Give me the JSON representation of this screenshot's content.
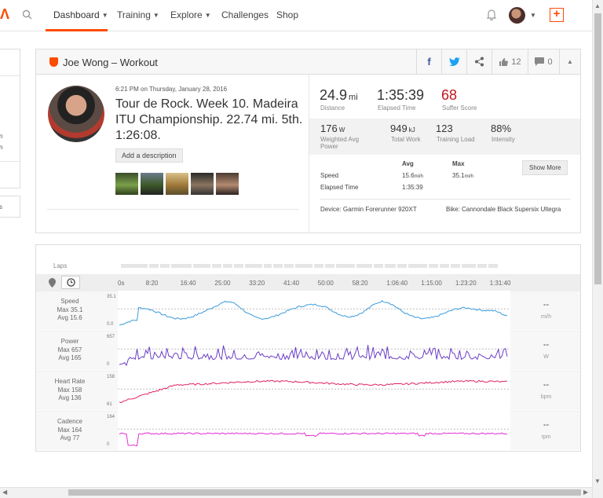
{
  "nav": {
    "items": [
      {
        "label": "Dashboard",
        "caret": true
      },
      {
        "label": "Training",
        "caret": true
      },
      {
        "label": "Explore",
        "caret": true
      },
      {
        "label": "Challenges",
        "caret": false
      },
      {
        "label": "Shop",
        "caret": false
      }
    ]
  },
  "activity": {
    "header_title": "Joe Wong – Workout",
    "kudos_count": "12",
    "comments_count": "0",
    "date": "6:21 PM on Thursday, January 28, 2016",
    "title": "Tour de Rock. Week 10. Madeira ITU Championship. 22.74 mi. 5th. 1:26:08.",
    "add_description": "Add a description",
    "stats": {
      "distance_value": "24.9",
      "distance_unit": "mi",
      "distance_label": "Distance",
      "elapsed_value": "1:35:39",
      "elapsed_label": "Elapsed Time",
      "suffer_value": "68",
      "suffer_label": "Suffer Score",
      "power_value": "176",
      "power_unit": "W",
      "power_label": "Weighted Avg Power",
      "work_value": "949",
      "work_unit": "kJ",
      "work_label": "Total Work",
      "load_value": "123",
      "load_label": "Training Load",
      "intensity_value": "88%",
      "intensity_label": "Intensity"
    },
    "table": {
      "col_avg": "Avg",
      "col_max": "Max",
      "speed_label": "Speed",
      "speed_avg": "15.6",
      "speed_avg_unit": "mi/h",
      "speed_max": "35.1",
      "speed_max_unit": "mi/h",
      "elapsed_label": "Elapsed Time",
      "elapsed_avg": "1:35:39"
    },
    "show_more": "Show More",
    "device": "Device: Garmin Forerunner 920XT",
    "bike": "Bike: Cannondale Black Supersix Ultegra"
  },
  "analysis": {
    "laps_label": "Laps",
    "time_ticks": [
      "0s",
      "8:20",
      "16:40",
      "25:00",
      "33:20",
      "41:40",
      "50:00",
      "58:20",
      "1:06:40",
      "1:15:00",
      "1:23:20",
      "1:31:40"
    ],
    "rows": [
      {
        "label": "Speed",
        "max": "Max 35.1",
        "avg": "Avg 15.6",
        "scale_top": "35.1",
        "scale_bottom": "0.0",
        "value": "--",
        "unit": "mi/h",
        "color": "#3a9ad9"
      },
      {
        "label": "Power",
        "max": "Max 657",
        "avg": "Avg 165",
        "scale_top": "657",
        "scale_bottom": "0",
        "value": "--",
        "unit": "W",
        "color": "#6b3fc7"
      },
      {
        "label": "Heart Rate",
        "max": "Max 158",
        "avg": "Avg 136",
        "scale_top": "158",
        "scale_bottom": "61",
        "value": "--",
        "unit": "bpm",
        "color": "#e0245e"
      },
      {
        "label": "Cadence",
        "max": "Max 164",
        "avg": "Avg 77",
        "scale_top": "164",
        "scale_bottom": "0",
        "value": "--",
        "unit": "rpm",
        "color": "#e02dd1"
      }
    ]
  },
  "colors": {
    "accent": "#fc4c02",
    "suffer": "#c0161b"
  }
}
